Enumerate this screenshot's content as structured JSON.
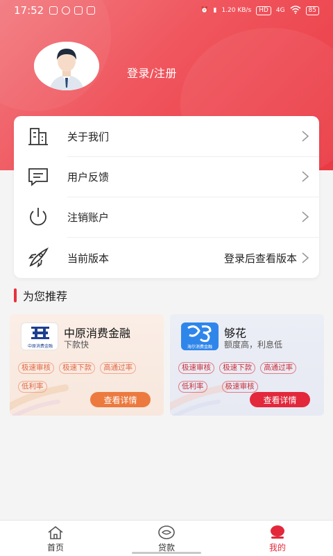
{
  "status_bar": {
    "time": "17:52",
    "network_speed": "1.20 KB/s",
    "hd_label": "HD",
    "network_label": "4G",
    "battery": "85"
  },
  "profile": {
    "login_label": "登录/注册"
  },
  "menu": {
    "items": [
      {
        "label": "关于我们",
        "value": "",
        "icon": "building-icon"
      },
      {
        "label": "用户反馈",
        "value": "",
        "icon": "feedback-icon"
      },
      {
        "label": "注销账户",
        "value": "",
        "icon": "power-icon"
      },
      {
        "label": "当前版本",
        "value": "登录后查看版本",
        "icon": "rocket-icon"
      }
    ]
  },
  "recommend": {
    "title": "为您推荐",
    "cards": [
      {
        "name": "中原消费金融",
        "desc": "下款快",
        "logo_text": "中原消费金融",
        "tags": [
          "极速审核",
          "极速下款",
          "高通过率",
          "低利率"
        ],
        "button": "查看详情",
        "accent": "#ec7a3f"
      },
      {
        "name": "够花",
        "desc": "额度高，利息低",
        "logo_text": "海尔消费金融",
        "tags": [
          "极速审核",
          "极速下款",
          "高通过率",
          "低利率",
          "极速审核"
        ],
        "button": "查看详情",
        "accent": "#e3283b"
      }
    ]
  },
  "tabbar": {
    "tabs": [
      {
        "label": "首页",
        "icon": "home-icon",
        "active": false
      },
      {
        "label": "贷款",
        "icon": "eye-icon",
        "active": false
      },
      {
        "label": "我的",
        "icon": "user-icon",
        "active": true
      }
    ]
  },
  "colors": {
    "brand": "#e8323c",
    "orange_button": "#ec7a3f",
    "red_button": "#e3283b"
  }
}
